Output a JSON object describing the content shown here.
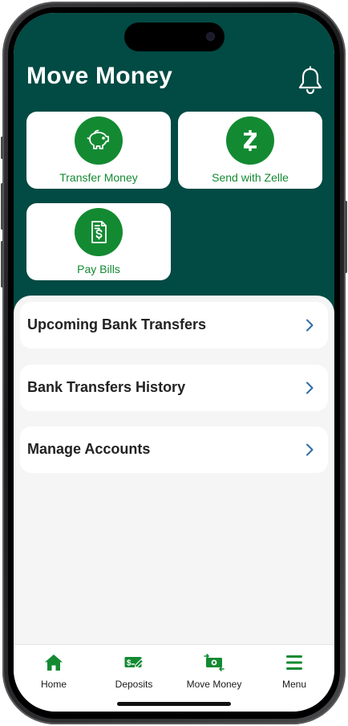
{
  "header": {
    "title": "Move Money",
    "notifications_icon": "bell-icon"
  },
  "tiles": [
    {
      "label": "Transfer Money",
      "icon": "piggy-bank-icon"
    },
    {
      "label": "Send with Zelle",
      "icon": "zelle-icon"
    },
    {
      "label": "Pay Bills",
      "icon": "bill-icon"
    }
  ],
  "list": [
    {
      "label": "Upcoming Bank Transfers",
      "icon": "chevron-right-icon"
    },
    {
      "label": "Bank Transfers History",
      "icon": "chevron-right-icon"
    },
    {
      "label": "Manage Accounts",
      "icon": "chevron-right-icon"
    }
  ],
  "tabbar": {
    "items": [
      {
        "label": "Home",
        "icon": "home-icon"
      },
      {
        "label": "Deposits",
        "icon": "deposit-check-icon"
      },
      {
        "label": "Move Money",
        "icon": "money-transfer-icon"
      },
      {
        "label": "Menu",
        "icon": "hamburger-menu-icon"
      }
    ]
  },
  "colors": {
    "header_bg": "#024a44",
    "accent_green": "#138a32",
    "chevron_blue": "#2e6da4",
    "page_bg": "#f5f5f5"
  }
}
